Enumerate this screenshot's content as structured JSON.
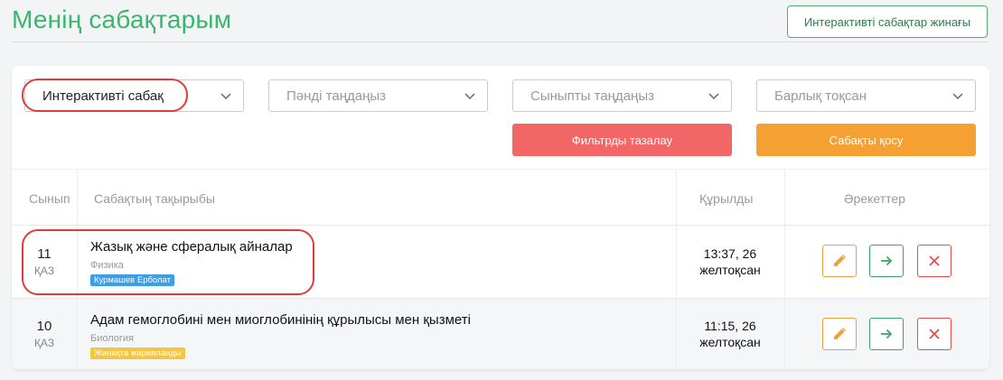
{
  "header": {
    "title": "Менің сабақтарым",
    "collection_button": "Интерактивті сабақтар жинағы"
  },
  "filters": {
    "type": {
      "value": "Интерактивті сабақ"
    },
    "subject": {
      "placeholder": "Пәнді таңдаңыз"
    },
    "grade": {
      "placeholder": "Сыныпты таңдаңыз"
    },
    "quarter": {
      "placeholder": "Барлық тоқсан"
    }
  },
  "buttons": {
    "clear_filters": "Фильтрды тазалау",
    "add_lesson": "Сабақты қосу"
  },
  "table": {
    "columns": [
      "Сынып",
      "Сабақтың тақырыбы",
      "Құрылды",
      "Әрекеттер"
    ],
    "rows": [
      {
        "grade": "11",
        "lang": "ҚАЗ",
        "title": "Жазық және сфералық айналар",
        "subject": "Физика",
        "badge": "Курмашев Ерболат",
        "created_time": "13:37, 26",
        "created_date": "желтоқсан"
      },
      {
        "grade": "10",
        "lang": "ҚАЗ",
        "title": "Адам гемоглобині мен миоглобинінің құрылысы мен қызметі",
        "subject": "Биология",
        "badge": "Жинақта жарияланды",
        "created_time": "11:15, 26",
        "created_date": "желтоқсан"
      }
    ]
  },
  "colors": {
    "title_green": "#3cb56e",
    "clear_red": "#f26666",
    "add_orange": "#f5a033",
    "edit_orange": "#f0a03a",
    "go_green": "#3aa663",
    "delete_red": "#e94c4c",
    "badge_blue": "#3d9ee8",
    "badge_yellow": "#f4c542",
    "highlight_red": "#e23b3b"
  },
  "icons": [
    "chevron-down-icon",
    "pencil-icon",
    "arrow-right-icon",
    "close-icon"
  ]
}
